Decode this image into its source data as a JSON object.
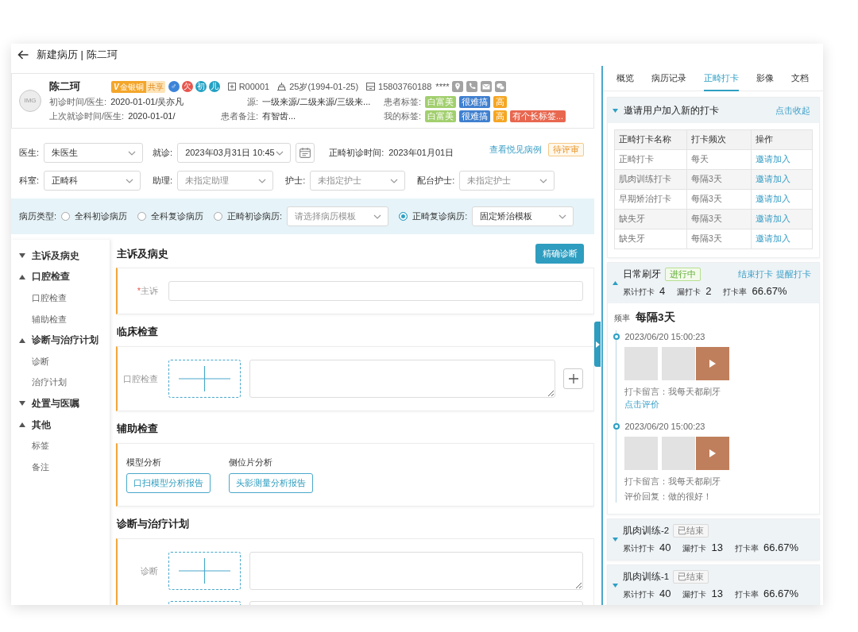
{
  "header": {
    "title": "新建病历 | 陈二珂"
  },
  "patient": {
    "avatar": "IMG",
    "name": "陈二珂",
    "member": {
      "mark": "V",
      "label": "金银铜",
      "share": "共享"
    },
    "flags": [
      {
        "text": "♂",
        "color": "#3c84d8"
      },
      {
        "text": "欠",
        "color": "#e8554d"
      },
      {
        "text": "初",
        "color": "#22a1c4"
      },
      {
        "text": "儿",
        "color": "#22a1c4"
      }
    ],
    "record_no": "R00001",
    "age": "25岁(1994-01-25)",
    "phone": "15803760188",
    "masked_info": "****",
    "fields": [
      {
        "kind": "text",
        "label": "初诊时间/医生:",
        "value": "2020-01-01/吴亦凡"
      },
      {
        "kind": "text",
        "label": "源:",
        "value": "一级来源/二级来源/三级来..."
      },
      {
        "kind": "tags",
        "label": "患者标签:",
        "tags": [
          {
            "text": "白富美",
            "color": "#a2cf6e"
          },
          {
            "text": "很难搞",
            "color": "#3f7fcf"
          },
          {
            "text": "高",
            "color": "#f5a623"
          }
        ]
      },
      {
        "kind": "text",
        "label": "上次就诊时间/医生:",
        "value": "2020-01-01/"
      },
      {
        "kind": "text",
        "label": "患者备注:",
        "value": "有智齿..."
      },
      {
        "kind": "tags",
        "label": "我的标签:",
        "tags": [
          {
            "text": "白富美",
            "color": "#a2cf6e"
          },
          {
            "text": "很难搞",
            "color": "#3f7fcf"
          },
          {
            "text": "高",
            "color": "#f5a623"
          },
          {
            "text": "有个长标签...",
            "color": "#e8674f"
          }
        ]
      }
    ]
  },
  "visit": {
    "rows": [
      [
        {
          "kind": "select",
          "label": "医生:",
          "value": "朱医生"
        },
        {
          "kind": "datetime",
          "label": "就诊:",
          "value": "2023年03月31日 10:45"
        },
        {
          "kind": "text",
          "label": "正畸初诊时间:",
          "value": "2023年01月01日"
        }
      ],
      [
        {
          "kind": "select",
          "label": "科室:",
          "value": "正畸科"
        },
        {
          "kind": "select",
          "label": "助理:",
          "placeholder": "未指定助理"
        },
        {
          "kind": "select",
          "label": "护士:",
          "placeholder": "未指定护士"
        },
        {
          "kind": "select",
          "label": "配台护士:",
          "placeholder": "未指定护士"
        }
      ]
    ],
    "case_link": "查看悦见病例",
    "review_status": "待评审"
  },
  "record_type": {
    "label": "病历类型:",
    "options": [
      {
        "label": "全科初诊病历",
        "selected": false
      },
      {
        "label": "全科复诊病历",
        "selected": false
      },
      {
        "label": "正畸初诊病历:",
        "selected": false,
        "template": {
          "placeholder": "请选择病历模板"
        }
      },
      {
        "label": "正畸复诊病历:",
        "selected": true,
        "template": {
          "value": "固定矫治模板"
        }
      }
    ]
  },
  "nav": [
    {
      "label": "主诉及病史",
      "expanded": false
    },
    {
      "label": "口腔检查",
      "expanded": true,
      "children": [
        {
          "label": "口腔检查"
        },
        {
          "label": "辅助检查"
        }
      ]
    },
    {
      "label": "诊断与治疗计划",
      "expanded": true,
      "children": [
        {
          "label": "诊断"
        },
        {
          "label": "治疗计划"
        }
      ]
    },
    {
      "label": "处置与医嘱",
      "expanded": false
    },
    {
      "label": "其他",
      "expanded": true,
      "children": [
        {
          "label": "标签"
        },
        {
          "label": "备注"
        }
      ]
    }
  ],
  "sections": [
    {
      "title": "主诉及病史",
      "action": "精确诊断",
      "fields": [
        {
          "kind": "text_input",
          "label": "主诉",
          "required_mark": "*"
        }
      ]
    },
    {
      "title": "临床检查",
      "fields": [
        {
          "kind": "image_note",
          "label": "口腔检查",
          "addable": true
        }
      ]
    },
    {
      "title": "辅助检查",
      "fields": [
        {
          "kind": "reports",
          "items": [
            {
              "label": "模型分析",
              "button": "口扫模型分析报告"
            },
            {
              "label": "侧位片分析",
              "button": "头影测量分析报告"
            }
          ]
        }
      ]
    },
    {
      "title": "诊断与治疗计划",
      "fields": [
        {
          "kind": "image_note",
          "label": "诊断"
        },
        {
          "kind": "image_note"
        }
      ]
    }
  ],
  "side_tabs": [
    {
      "label": "概览",
      "selected": false
    },
    {
      "label": "病历记录",
      "selected": false
    },
    {
      "label": "正畸打卡",
      "selected": true
    },
    {
      "label": "影像",
      "selected": false
    },
    {
      "label": "文档",
      "selected": false
    }
  ],
  "invite": {
    "title": "邀请用户加入新的打卡",
    "collapse_link": "点击收起",
    "table": {
      "columns": [
        "正畸打卡名称",
        "打卡频次",
        "操作"
      ],
      "rows": [
        {
          "name": "正畸打卡",
          "frequency": "每天",
          "action": "邀请加入"
        },
        {
          "name": "肌肉训练打卡",
          "frequency": "每隔3天",
          "action": "邀请加入"
        },
        {
          "name": "早期矫治打卡",
          "frequency": "每隔3天",
          "action": "邀请加入"
        },
        {
          "name": "缺失牙",
          "frequency": "每隔3天",
          "action": "邀请加入"
        },
        {
          "name": "缺失牙",
          "frequency": "每隔3天",
          "action": "邀请加入"
        }
      ]
    }
  },
  "checkins": [
    {
      "title": "日常刷牙",
      "status": {
        "label": "进行中",
        "kind": "active"
      },
      "expanded": true,
      "actions": [
        "结束打卡",
        "提醒打卡"
      ],
      "stats": [
        {
          "label": "累计打卡",
          "value": "4"
        },
        {
          "label": "漏打卡",
          "value": "2"
        },
        {
          "label": "打卡率",
          "value": "66.67%"
        }
      ],
      "frequency_label": "频率",
      "frequency": "每隔3天",
      "entries": [
        {
          "time": "2023/06/20 15:00:23",
          "media": [
            {
              "kind": "photo"
            },
            {
              "kind": "photo"
            },
            {
              "kind": "video"
            }
          ],
          "message_label": "打卡留言：",
          "message": "我每天都刷牙",
          "review_link": "点击评价"
        },
        {
          "time": "2023/06/20 15:00:23",
          "media": [
            {
              "kind": "photo"
            },
            {
              "kind": "photo"
            },
            {
              "kind": "video"
            }
          ],
          "message_label": "打卡留言：",
          "message": "我每天都刷牙",
          "reply_label": "评价回复：",
          "reply": "做的很好！"
        }
      ]
    },
    {
      "title": "肌肉训练-2",
      "status": {
        "label": "已结束",
        "kind": "ended"
      },
      "expanded": false,
      "stats": [
        {
          "label": "累计打卡",
          "value": "40"
        },
        {
          "label": "漏打卡",
          "value": "13"
        },
        {
          "label": "打卡率",
          "value": "66.67%"
        }
      ]
    },
    {
      "title": "肌肉训练-1",
      "status": {
        "label": "已结束",
        "kind": "ended"
      },
      "expanded": false,
      "stats": [
        {
          "label": "累计打卡",
          "value": "40"
        },
        {
          "label": "漏打卡",
          "value": "13"
        },
        {
          "label": "打卡率",
          "value": "66.67%"
        }
      ]
    }
  ]
}
